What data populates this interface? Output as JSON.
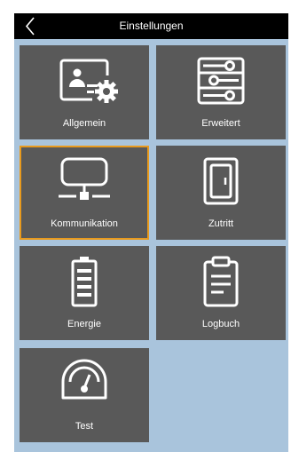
{
  "header": {
    "title": "Einstellungen",
    "back_icon": "chevron-left-icon"
  },
  "tiles": [
    {
      "label": "Allgemein",
      "icon": "user-settings-icon",
      "selected": false
    },
    {
      "label": "Erweitert",
      "icon": "sliders-icon",
      "selected": false
    },
    {
      "label": "Kommunikation",
      "icon": "network-icon",
      "selected": true
    },
    {
      "label": "Zutritt",
      "icon": "door-icon",
      "selected": false
    },
    {
      "label": "Energie",
      "icon": "battery-icon",
      "selected": false
    },
    {
      "label": "Logbuch",
      "icon": "clipboard-icon",
      "selected": false
    },
    {
      "label": "Test",
      "icon": "gauge-icon",
      "selected": false
    }
  ],
  "colors": {
    "background": "#a9c4dc",
    "header": "#000000",
    "tile": "#595959",
    "selected_border": "#e89a1d",
    "icon": "#ffffff"
  }
}
